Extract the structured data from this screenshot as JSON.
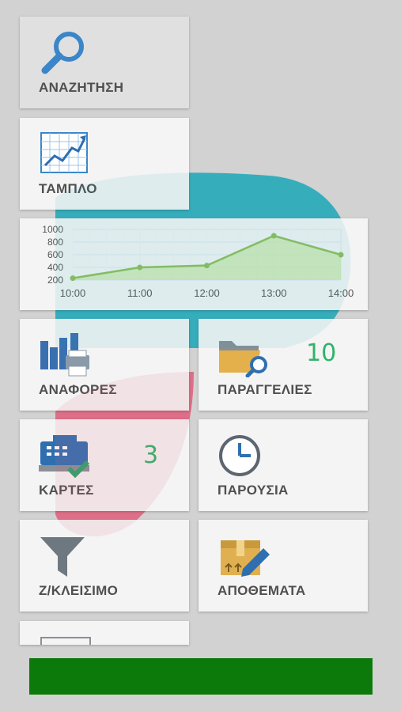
{
  "menu": {
    "search_label": "ΑΝΑΖΗΤΗΣΗ",
    "dashboard_label": "ΤΑΜΠΛΟ",
    "reports_label": "ΑΝΑΦΟΡΕΣ",
    "orders_label": "ΠΑΡΑΓΓΕΛΙΕΣ",
    "orders_badge": "10",
    "cards_label": "ΚΑΡΤΕΣ",
    "cards_badge": "3",
    "attendance_label": "ΠΑΡΟΥΣΙΑ",
    "z_close_label": "Ζ/ΚΛΕΙΣΙΜΟ",
    "stock_label": "ΑΠΟΘΕΜΑΤΑ"
  },
  "colors": {
    "badge": "#2fb36a",
    "chart_line": "#8fbf5a",
    "chart_fill": "#cfe8b2",
    "bottom_bar": "#0b7a0b"
  },
  "chart_data": {
    "type": "area",
    "x": [
      "10:00",
      "11:00",
      "12:00",
      "13:00",
      "14:00"
    ],
    "values": [
      230,
      400,
      430,
      900,
      600
    ],
    "ylim": [
      200,
      1000
    ],
    "yticks": [
      "1000",
      "800",
      "600",
      "400",
      "200"
    ],
    "grid": true
  }
}
